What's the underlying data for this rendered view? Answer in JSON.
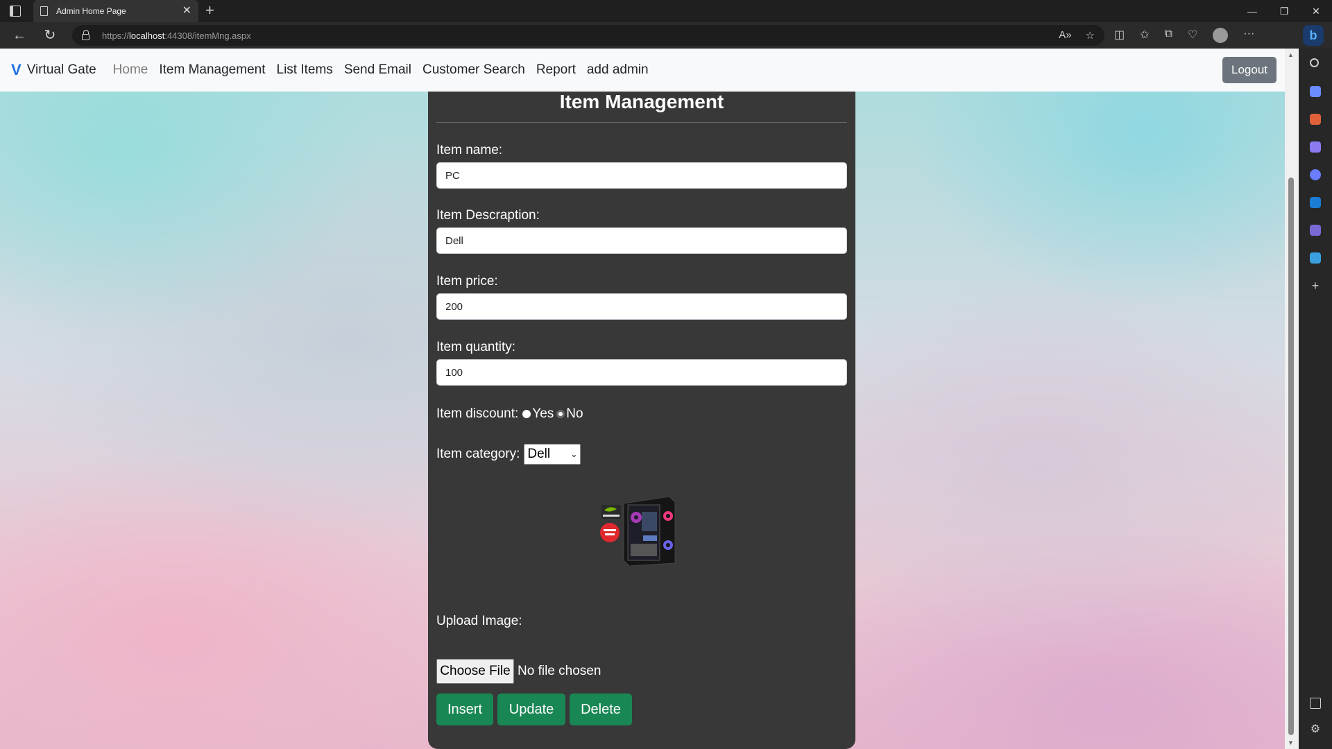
{
  "browser": {
    "tab_title": "Admin Home Page",
    "url_scheme": "https://",
    "url_host": "localhost",
    "url_path": ":44308/itemMng.aspx"
  },
  "navbar": {
    "brand_logo": "V",
    "brand": "Virtual Gate",
    "links": [
      "Home",
      "Item Management",
      "List Items",
      "Send Email",
      "Customer Search",
      "Report",
      "add admin"
    ],
    "logout": "Logout"
  },
  "form": {
    "title": "Item Management",
    "name_label": "Item name:",
    "name_value": "PC",
    "desc_label": "Item Descraption:",
    "desc_value": "Dell",
    "price_label": "Item price:",
    "price_value": "200",
    "qty_label": "Item quantity:",
    "qty_value": "100",
    "discount_label": "Item discount:",
    "discount_yes": "Yes",
    "discount_no": "No",
    "discount_selected": "No",
    "category_label": "Item category:",
    "category_value": "Dell",
    "upload_label": "Upload Image:",
    "choose_file": "Choose File",
    "no_file": "No file chosen",
    "insert": "Insert",
    "update": "Update",
    "delete": "Delete"
  },
  "colors": {
    "panel_bg": "#383838",
    "action_button": "#198754",
    "brand_logo": "#1f6fe0"
  }
}
